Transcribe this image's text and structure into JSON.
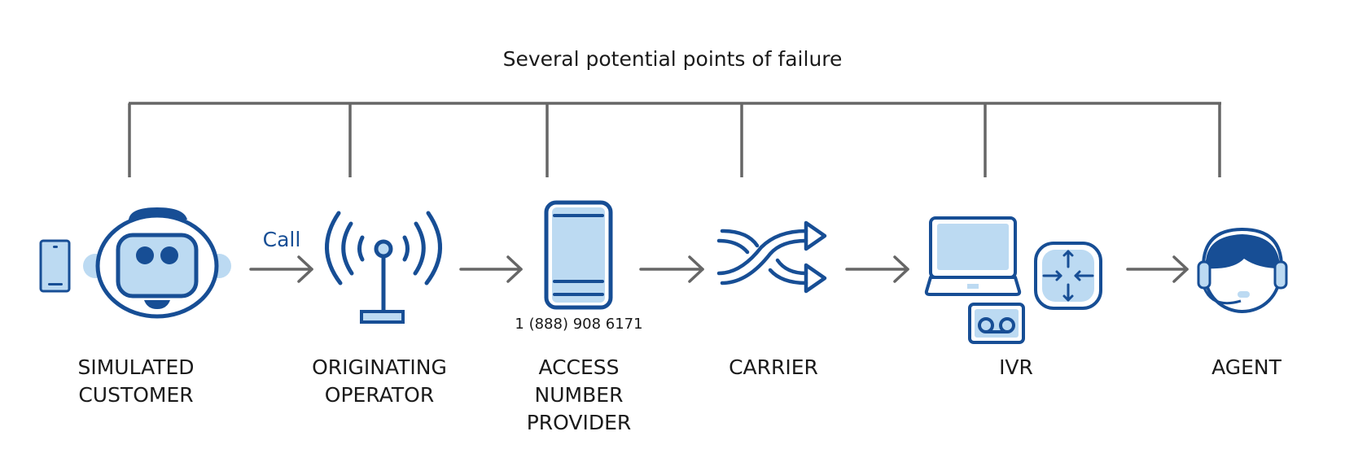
{
  "title": "Several potential points of failure",
  "colors": {
    "dark_blue": "#174e95",
    "light_blue": "#bcdaf2",
    "connector_gray": "#666666",
    "text": "#1a1a1a"
  },
  "call_label": "Call",
  "access_number": "1 (888) 908 6171",
  "stages": [
    {
      "id": "simulated-customer",
      "icon": "robot-icon",
      "lines": [
        "SIMULATED",
        "CUSTOMER"
      ]
    },
    {
      "id": "originating-operator",
      "icon": "antenna-icon",
      "lines": [
        "ORIGINATING",
        "OPERATOR"
      ]
    },
    {
      "id": "access-number-provider",
      "icon": "phone-icon",
      "lines": [
        "ACCESS",
        "NUMBER",
        "PROVIDER"
      ]
    },
    {
      "id": "carrier",
      "icon": "shuffle-icon",
      "lines": [
        "CARRIER"
      ]
    },
    {
      "id": "ivr",
      "icon": "laptop-router-voicemail-icon",
      "lines": [
        "IVR"
      ]
    },
    {
      "id": "agent",
      "icon": "headset-agent-icon",
      "lines": [
        "AGENT"
      ]
    }
  ]
}
